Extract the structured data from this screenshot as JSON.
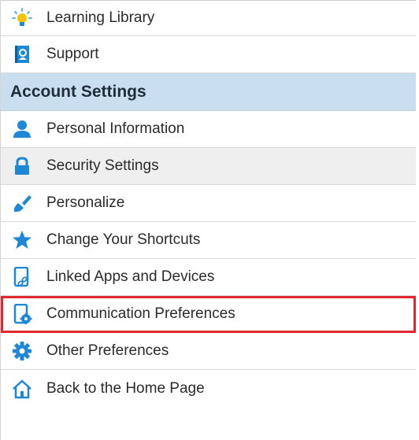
{
  "menu": {
    "top_items": [
      {
        "label": "Learning Library",
        "icon": "lightbulb-icon"
      },
      {
        "label": "Support",
        "icon": "support-book-icon"
      }
    ],
    "section_title": "Account Settings",
    "items": [
      {
        "label": "Personal Information",
        "icon": "person-icon"
      },
      {
        "label": "Security Settings",
        "icon": "lock-icon"
      },
      {
        "label": "Personalize",
        "icon": "paintbrush-icon"
      },
      {
        "label": "Change Your Shortcuts",
        "icon": "star-icon"
      },
      {
        "label": "Linked Apps and Devices",
        "icon": "linked-device-icon"
      },
      {
        "label": "Communication Preferences",
        "icon": "device-gear-icon"
      },
      {
        "label": "Other Preferences",
        "icon": "gear-icon"
      },
      {
        "label": "Back to the Home Page",
        "icon": "home-icon"
      }
    ]
  },
  "colors": {
    "icon_blue": "#1e88d6",
    "section_bg": "#c9dff0",
    "highlight_border": "#e0282e",
    "lightbulb_yellow": "#f2c500"
  }
}
